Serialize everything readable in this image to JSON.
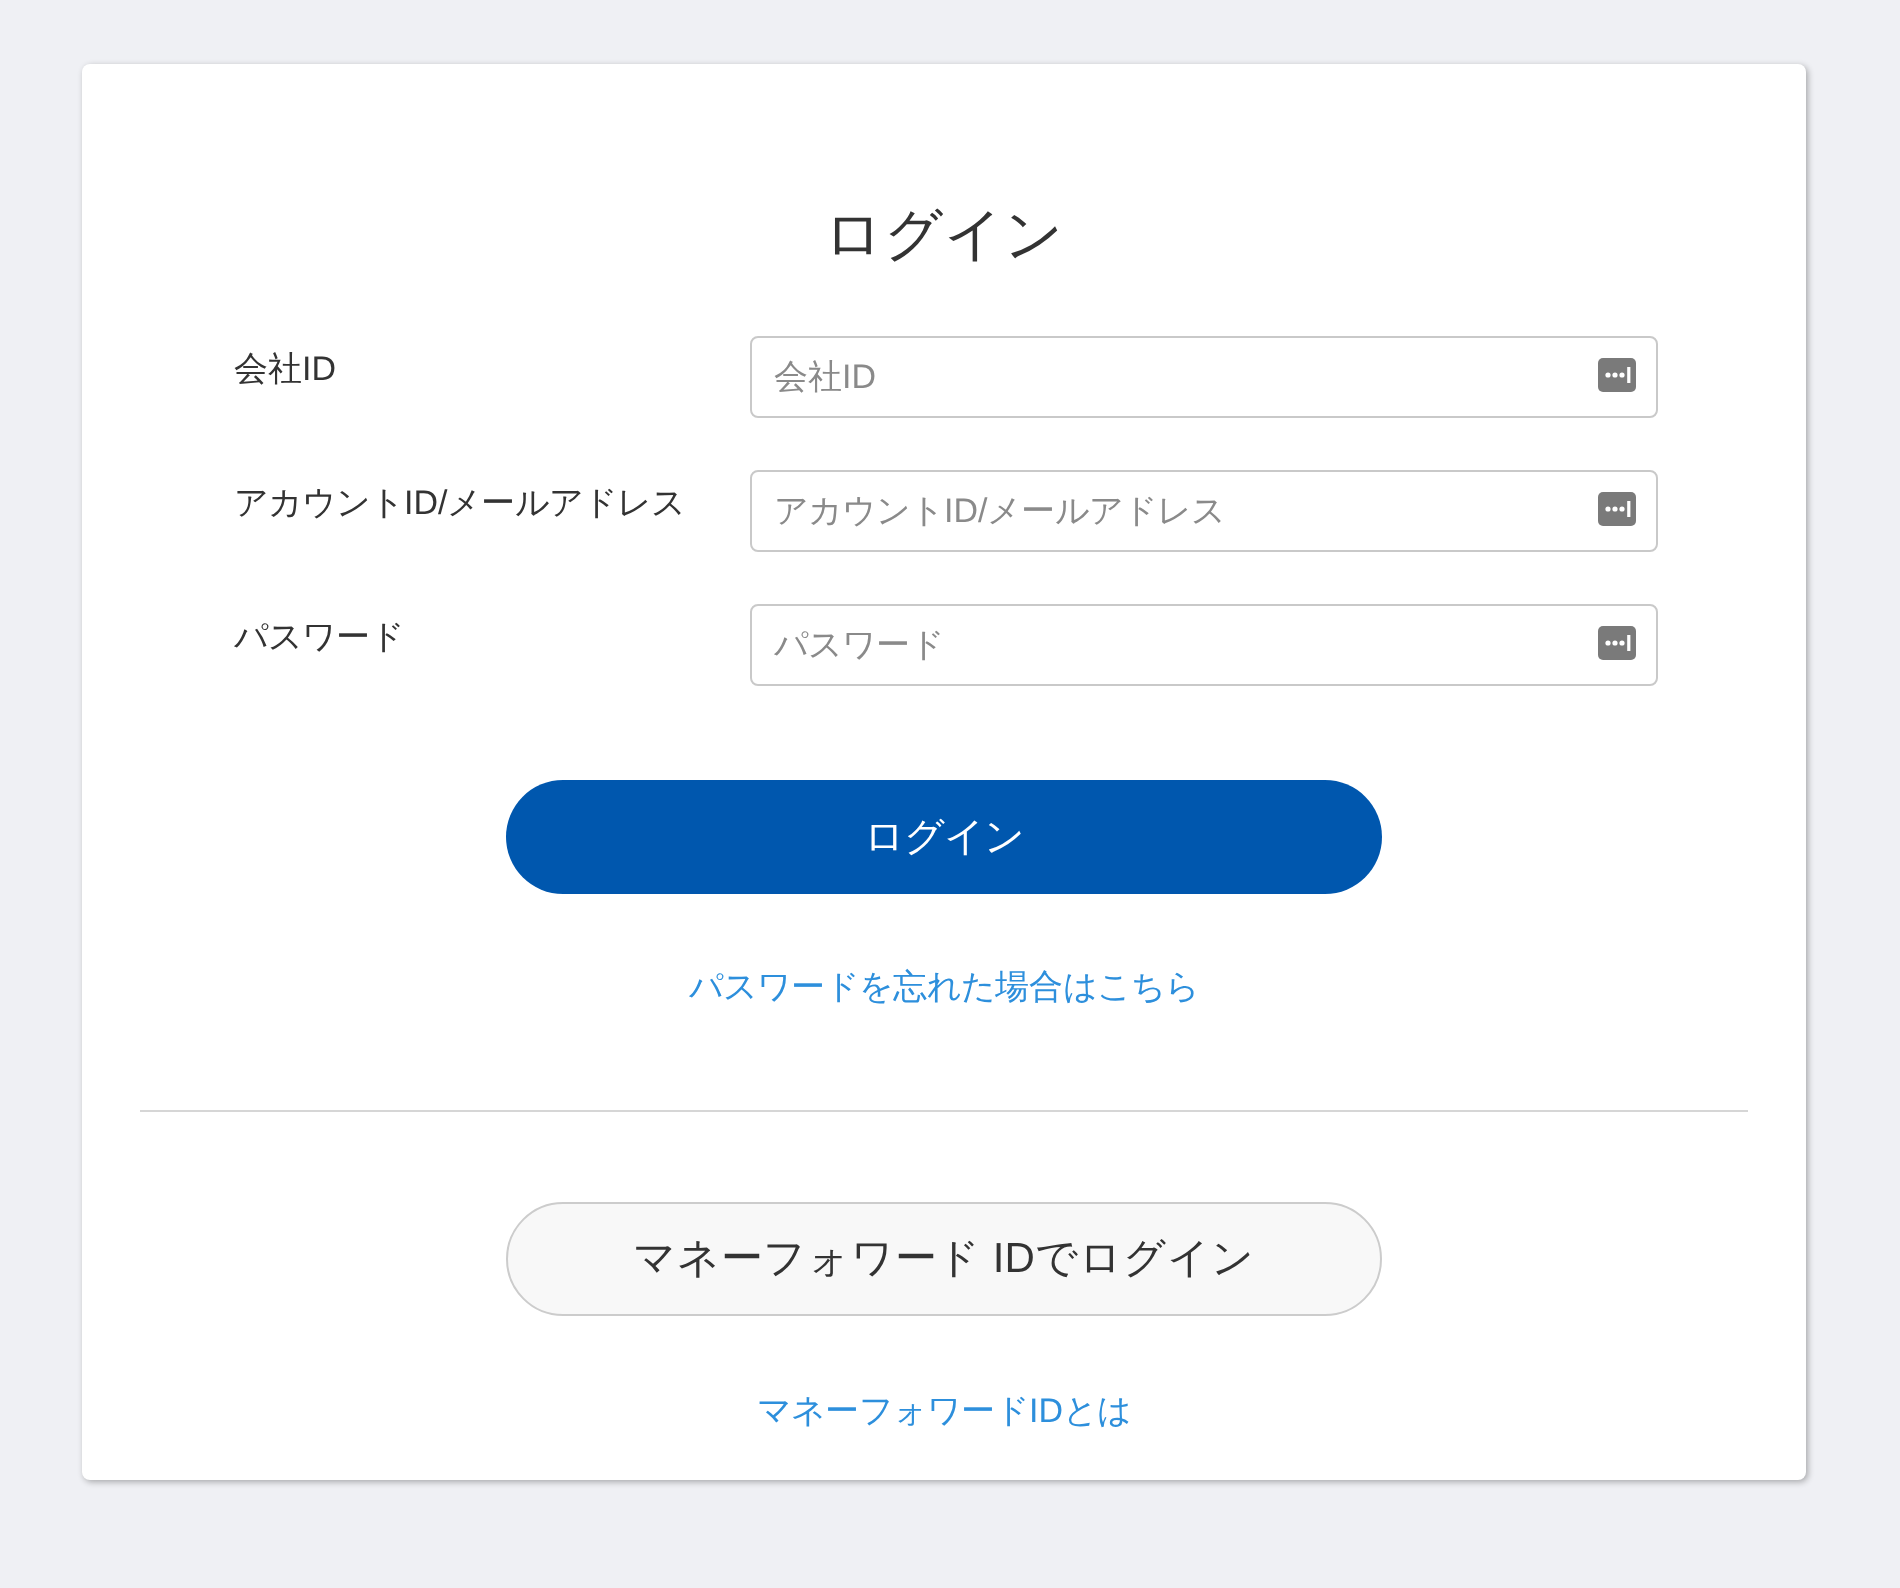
{
  "title": "ログイン",
  "fields": [
    {
      "label": "会社ID",
      "placeholder": "会社ID"
    },
    {
      "label": "アカウントID/メールアドレス",
      "placeholder": "アカウントID/メールアドレス"
    },
    {
      "label": "パスワード",
      "placeholder": "パスワード"
    }
  ],
  "login_button": "ログイン",
  "forgot_link": "パスワードを忘れた場合はこちら",
  "mf_button": "マネーフォワード IDでログイン",
  "about_link": "マネーフォワードIDとは"
}
